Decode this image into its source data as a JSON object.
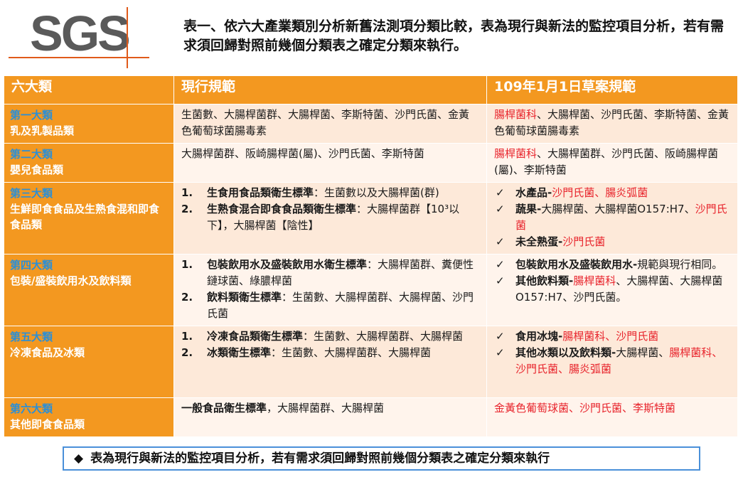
{
  "logo": {
    "text": "SGS"
  },
  "heading": "表一、依六大產業類別分析新舊法測項分類比較，表為現行與新法的監控項目分析，若有需求須回歸對照前幾個分類表之確定分類來執行。",
  "table": {
    "headers": [
      "六大類",
      "現行規範",
      "109年1月1日草案規範"
    ],
    "rows": [
      {
        "cat_num": "第一大類",
        "cat_name": "乳及乳製品類",
        "current": "生菌數、大腸桿菌群、大腸桿菌、李斯特菌、沙門氏菌、金黃色葡萄球菌腸毒素",
        "draft_red": "腸桿菌科",
        "draft_rest": "、大腸桿菌、沙門氏菌、李斯特菌、金黃色葡萄球菌腸毒素"
      },
      {
        "cat_num": "第二大類",
        "cat_name": "嬰兒食品類",
        "current": "大腸桿菌群、阪崎腸桿菌(屬)、沙門氏菌、李斯特菌",
        "draft_red": "腸桿菌科",
        "draft_rest": "、大腸桿菌群、沙門氏菌、阪崎腸桿菌(屬)、李斯特菌"
      },
      {
        "cat_num": "第三大類",
        "cat_name": "生鮮即食食品及生熟食混和即食食品類",
        "current_items": [
          {
            "num": "1.",
            "bold": "生食用食品類衛生標準",
            "text": "：生菌數以及大腸桿菌(群)"
          },
          {
            "num": "2.",
            "bold": "生熟食混合即食食品類衛生標準",
            "text": "：大腸桿菌群【10³以下】，大腸桿菌【陰性】"
          }
        ],
        "draft_items": [
          {
            "mark": "✓",
            "bold": "水產品",
            "sep": "-",
            "black": "",
            "red": "沙門氏菌、腸炎弧菌",
            "tail": ""
          },
          {
            "mark": "✓",
            "bold": "蔬果",
            "sep": "-",
            "black": "大腸桿菌、大腸桿菌O157:H7、",
            "red": "沙門氏菌",
            "tail": ""
          },
          {
            "mark": "✓",
            "bold": "未全熟蛋",
            "sep": "-",
            "black": "",
            "red": "沙門氏菌",
            "tail": ""
          }
        ]
      },
      {
        "cat_num": "第四大類",
        "cat_name": "包裝/盛裝飲用水及飲料類",
        "current_items": [
          {
            "num": "1.",
            "bold": "包裝飲用水及盛裝飲用水衛生標準",
            "text": "：大腸桿菌群、糞便性鏈球菌、綠膿桿菌"
          },
          {
            "num": "2.",
            "bold": "飲料類衛生標準",
            "text": "：生菌數、大腸桿菌群、大腸桿菌、沙門氏菌"
          }
        ],
        "draft_items": [
          {
            "mark": "✓",
            "bold": "包裝飲用水及盛裝飲用水",
            "sep": "-",
            "black": "規範與現行相同。",
            "red": "",
            "tail": ""
          },
          {
            "mark": "✓",
            "bold": "其他飲料類",
            "sep": "-",
            "black": "",
            "red": "腸桿菌科",
            "tail": "、大腸桿菌、大腸桿菌O157:H7、沙門氏菌。"
          }
        ]
      },
      {
        "cat_num": "第五大類",
        "cat_name": "冷凍食品及冰類",
        "current_items": [
          {
            "num": "1.",
            "bold": "冷凍食品類衛生標準",
            "text": "：生菌數、大腸桿菌群、大腸桿菌"
          },
          {
            "num": "2.",
            "bold": "冰類衛生標準",
            "text": "：生菌數、大腸桿菌群、大腸桿菌"
          }
        ],
        "draft_items": [
          {
            "mark": "✓",
            "bold": "食用冰塊",
            "sep": "-",
            "black": "",
            "red": "腸桿菌科、沙門氏菌",
            "tail": ""
          },
          {
            "mark": "✓",
            "bold": "其他冰類以及飲料類",
            "sep": "-",
            "black": "大腸桿菌、",
            "red": "腸桿菌科、沙門氏菌、腸炎弧菌",
            "tail": ""
          }
        ]
      },
      {
        "cat_num": "第六大類",
        "cat_name": "其他即食食品類",
        "current_bold": "一般食品衛生標準",
        "current_rest": "，大腸桿菌群、大腸桿菌",
        "draft_red": "金黃色葡萄球菌、沙門氏菌、李斯特菌",
        "draft_rest": ""
      }
    ]
  },
  "footer": {
    "bullet": "◆",
    "text": "表為現行與新法的監控項目分析，若有需求須回歸對照前幾個分類表之確定分類來執行"
  },
  "colors": {
    "accent_orange": "#f39820",
    "category_number_blue": "#2b8fd6",
    "highlight_red": "#e8242c",
    "logo_line": "#e05a1a",
    "footer_border": "#4a90d9"
  }
}
